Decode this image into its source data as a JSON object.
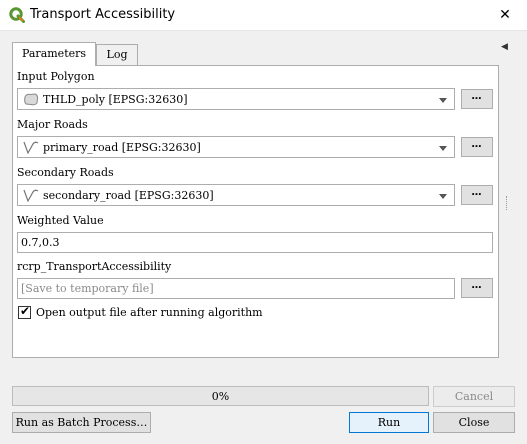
{
  "window": {
    "title": "Transport Accessibility",
    "close_glyph": "✕",
    "app_icon": "qgis-icon",
    "collapse_glyph": "◀"
  },
  "tabs": [
    {
      "label": "Parameters",
      "active": true
    },
    {
      "label": "Log",
      "active": false
    }
  ],
  "params": {
    "input_polygon": {
      "label": "Input Polygon",
      "value": "THLD_poly [EPSG:32630]",
      "icon": "polygon-layer-icon"
    },
    "major_roads": {
      "label": "Major Roads",
      "value": "primary_road [EPSG:32630]",
      "icon": "line-layer-icon"
    },
    "secondary_roads": {
      "label": "Secondary Roads",
      "value": "secondary_road [EPSG:32630]",
      "icon": "line-layer-icon"
    },
    "weighted_value": {
      "label": "Weighted Value",
      "value": "0.7,0.3"
    },
    "output": {
      "label": "rcrp_TransportAccessibility",
      "placeholder": "[Save to temporary file]"
    },
    "browse_label": "…",
    "open_output": {
      "label": "Open output file after running algorithm",
      "checked": true,
      "check_glyph": "✔"
    }
  },
  "progress": {
    "text": "0%",
    "value": 0
  },
  "buttons": {
    "cancel": "Cancel",
    "batch": "Run as Batch Process…",
    "run": "Run",
    "close": "Close"
  },
  "colors": {
    "qgis_green": "#589632",
    "qgis_yellow": "#ee7913",
    "focus_blue": "#0078d7"
  }
}
